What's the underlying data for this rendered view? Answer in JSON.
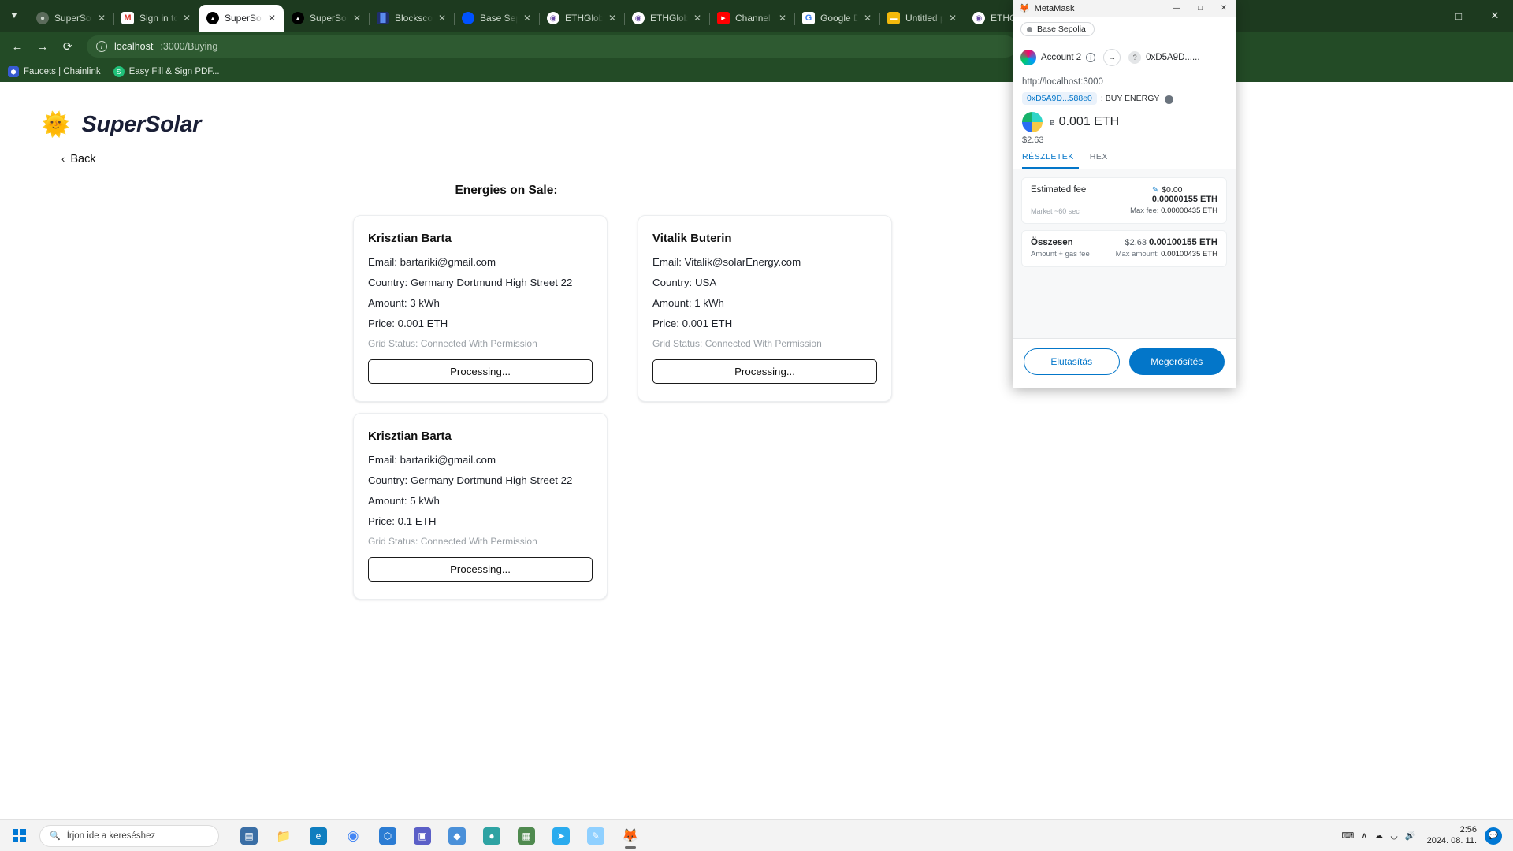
{
  "browser": {
    "tabs": [
      {
        "title": "SuperSolar",
        "favicon": "user-avatar-icon",
        "active": false
      },
      {
        "title": "Sign in to S",
        "favicon": "gmail-icon",
        "active": false
      },
      {
        "title": "SuperSolar",
        "favicon": "vercel-triangle-icon",
        "active": true
      },
      {
        "title": "SuperSolar",
        "favicon": "vercel-triangle-icon",
        "active": false
      },
      {
        "title": "Blockscout",
        "favicon": "blockscout-icon",
        "active": false
      },
      {
        "title": "Base Sepo",
        "favicon": "base-icon",
        "active": false
      },
      {
        "title": "ETHGlobal",
        "favicon": "ethglobal-icon",
        "active": false
      },
      {
        "title": "ETHGlobal",
        "favicon": "ethglobal-icon",
        "active": false
      },
      {
        "title": "Channel co",
        "favicon": "youtube-icon",
        "active": false
      },
      {
        "title": "Google Dis",
        "favicon": "google-icon",
        "active": false
      },
      {
        "title": "Untitled pr",
        "favicon": "notepad-icon",
        "active": false
      },
      {
        "title": "ETHGlobal",
        "favicon": "ethglobal-icon",
        "active": false
      }
    ],
    "tab_search_label": "Search tabs",
    "window_controls": {
      "minimize": "—",
      "maximize": "□",
      "close": "✕"
    },
    "toolbar": {
      "back": "←",
      "forward": "→",
      "reload": "⟳",
      "site_info": "i",
      "url_host": "localhost",
      "url_path": ":3000/Buying"
    },
    "bookmarks": [
      {
        "label": "Faucets | Chainlink",
        "favicon": "chainlink-icon"
      },
      {
        "label": "Easy Fill & Sign PDF...",
        "favicon": "smallpdf-icon"
      }
    ]
  },
  "page": {
    "logo_icon": "🌞",
    "brand": "SuperSolar",
    "back_label": "Back",
    "back_chevron": "‹",
    "title": "Energies on Sale:",
    "cards": [
      {
        "name": "Krisztian Barta",
        "email": "Email: bartariki@gmail.com",
        "country": "Country: Germany Dortmund High Street 22",
        "amount": "Amount: 3 kWh",
        "price": "Price: 0.001 ETH",
        "grid_status": "Grid Status: Connected With Permission",
        "button": "Processing..."
      },
      {
        "name": "Vitalik Buterin",
        "email": "Email: Vitalik@solarEnergy.com",
        "country": "Country: USA",
        "amount": "Amount: 1 kWh",
        "price": "Price: 0.001 ETH",
        "grid_status": "Grid Status: Connected With Permission",
        "button": "Processing..."
      },
      {
        "name": "Krisztian Barta",
        "email": "Email: bartariki@gmail.com",
        "country": "Country: Germany Dortmund High Street 22",
        "amount": "Amount: 5 kWh",
        "price": "Price: 0.1 ETH",
        "grid_status": "Grid Status: Connected With Permission",
        "button": "Processing..."
      }
    ]
  },
  "metamask": {
    "window_title": "MetaMask",
    "fox_icon": "🦊",
    "minimize": "—",
    "maximize": "□",
    "close": "✕",
    "network": "Base Sepolia",
    "account_from": "Account 2",
    "account_to": "0xD5A9D......",
    "arrow": "→",
    "origin": "http://localhost:3000",
    "contract": "0xD5A9D...588e0",
    "method_separator": ":",
    "method": "BUY ENERGY",
    "amount_symbol": "Ƀ",
    "amount": "0.001 ETH",
    "fiat": "$2.63",
    "tabs": [
      {
        "label": "RÉSZLETEK",
        "active": true
      },
      {
        "label": "HEX",
        "active": false
      }
    ],
    "fee": {
      "label": "Estimated fee",
      "fiat": "$0.00",
      "edit_icon": "✎",
      "eth": "0.00000155 ETH",
      "market_label": "Market",
      "market_time": "~60 sec",
      "max_fee_label": "Max fee:",
      "max_fee_value": "0.00000435 ETH"
    },
    "total": {
      "label": "Összesen",
      "fiat": "$2.63",
      "eth": "0.00100155 ETH",
      "sub_label": "Amount + gas fee",
      "max_amount_label": "Max amount:",
      "max_amount_value": "0.00100435 ETH"
    },
    "reject_label": "Elutasítás",
    "confirm_label": "Megerősítés",
    "accent": "#0376c9"
  },
  "taskbar": {
    "start_label": "Start",
    "search_placeholder": "Írjon ide a kereséshez",
    "search_icon": "🔍",
    "apps": [
      {
        "name": "task-view",
        "glyph": "▤",
        "color": "#3a6ea5"
      },
      {
        "name": "file-explorer",
        "glyph": "📁",
        "color": "#ffb900"
      },
      {
        "name": "microsoft-edge",
        "glyph": "e",
        "color": "#0f7ebf"
      },
      {
        "name": "google-chrome",
        "glyph": "◉",
        "color": "#4285f4"
      },
      {
        "name": "visual-studio-code",
        "glyph": "⬡",
        "color": "#2b7cd3"
      },
      {
        "name": "teams",
        "glyph": "▣",
        "color": "#5b5fc7"
      },
      {
        "name": "brave-browser",
        "glyph": "◆",
        "color": "#4a90d9"
      },
      {
        "name": "remix-ide",
        "glyph": "●",
        "color": "#2ea3a3"
      },
      {
        "name": "calculator",
        "glyph": "▦",
        "color": "#4f8a4f"
      },
      {
        "name": "telegram",
        "glyph": "➤",
        "color": "#2aabee"
      },
      {
        "name": "paint",
        "glyph": "✎",
        "color": "#8fd0ff"
      },
      {
        "name": "metamask",
        "glyph": "🦊",
        "color": "#f6851b"
      }
    ],
    "tray": {
      "keyboard_icon": "⌨",
      "chevron_icon": "∧",
      "cloud_icon": "☁",
      "network_icon": "◡",
      "volume_icon": "🔊",
      "time": "2:56",
      "date": "2024. 08. 11.",
      "notification_icon": "💬"
    }
  }
}
